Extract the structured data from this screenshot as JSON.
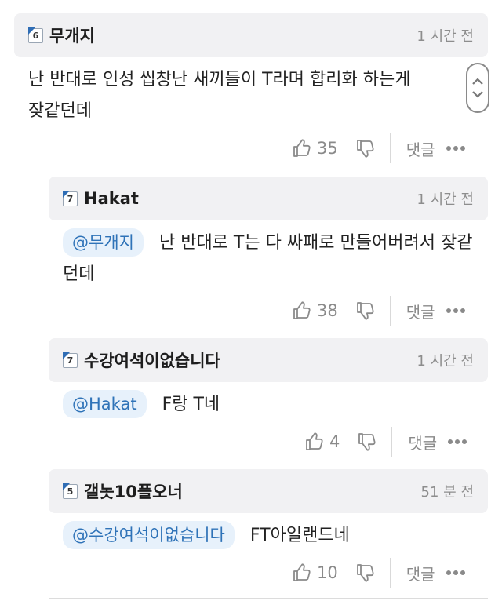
{
  "comments": [
    {
      "badge": "6",
      "nickname": "무개지",
      "time": "1 시간 전",
      "mention": "",
      "text_line1": "난 반대로 인성 씹창난 새끼들이 T라며 합리화 하는게",
      "text_line2": "잦같던데",
      "likes": "35",
      "reply_label": "댓글"
    },
    {
      "badge": "7",
      "nickname": "Hakat",
      "time": "1 시간 전",
      "mention": "@무개지",
      "text_line1": "난 반대로 T는 다 싸패로 만들어버려서 잦같",
      "text_line2": "던데",
      "likes": "38",
      "reply_label": "댓글"
    },
    {
      "badge": "7",
      "nickname": "수강여석이없습니다",
      "time": "1 시간 전",
      "mention": "@Hakat",
      "text_line1": "F랑 T네",
      "likes": "4",
      "reply_label": "댓글"
    },
    {
      "badge": "5",
      "nickname": "갤놋10플오너",
      "time": "51 분 전",
      "mention": "@수강여석이없습니다",
      "text_line1": "FT아일랜드네",
      "likes": "10",
      "reply_label": "댓글"
    }
  ],
  "icons": {
    "like": "thumbs-up-icon",
    "dislike": "thumbs-down-icon",
    "more": "more-dots-icon",
    "scroll_up": "chevron-up-icon",
    "scroll_down": "chevron-down-icon"
  },
  "colors": {
    "mention_text": "#2f73b8",
    "mention_bg": "#e7f1fb",
    "header_bg": "#f1f1f3",
    "badge_corner": "#2f6db5"
  }
}
